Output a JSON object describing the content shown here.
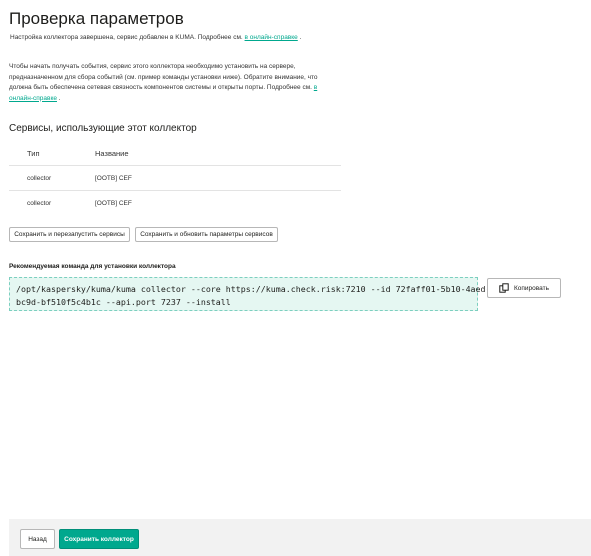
{
  "page": {
    "title": "Проверка параметров",
    "note_text": "Настройка коллектора завершена, сервис добавлен в KUMA. Подробнее см. ",
    "note_link": "в онлайн-справке",
    "note_end": " .",
    "para_text": "Чтобы начать получать события, сервис этого коллектора необходимо установить на сервере, предназначенном для сбора событий (см. пример команды установки ниже). Обратите внимание, что должна быть обеспечена сетевая связность компонентов системы и открыты порты. Подробнее см. ",
    "para_link": "в онлайн-справке",
    "para_end": " ."
  },
  "services": {
    "title": "Сервисы, использующие этот коллектор",
    "headers": {
      "type": "Тип",
      "name": "Название"
    },
    "rows": [
      {
        "type": "collector",
        "name": "[OOTB] CEF"
      },
      {
        "type": "collector",
        "name": "[OOTB] CEF"
      }
    ],
    "restart_label": "Сохранить и перезапустить сервисы",
    "update_label": "Сохранить и обновить параметры сервисов"
  },
  "command": {
    "label": "Рекомендуемая команда для установки коллектора",
    "text": "/opt/kaspersky/kuma/kuma collector --core https://kuma.check.risk:7210 --id 72faff01-5b10-4aed-\nbc9d-bf510f5c4b1c --api.port 7237 --install",
    "copy_label": "Копировать",
    "copy_icon": "copy-icon"
  },
  "footer": {
    "back_label": "Назад",
    "save_label": "Сохранить коллектор"
  },
  "colors": {
    "accent": "#00a88e",
    "command_bg": "#e5f7f2",
    "footer_bg": "#f2f2f2"
  }
}
